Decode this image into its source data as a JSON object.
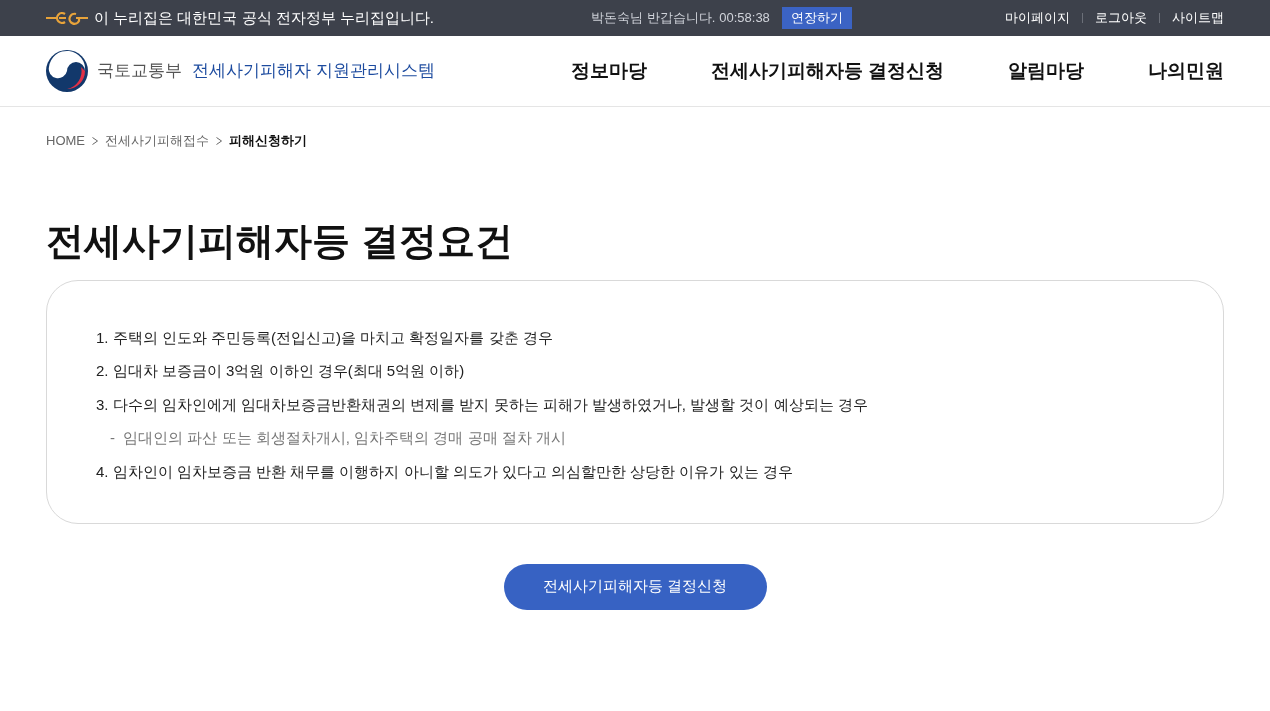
{
  "top_bar": {
    "notice": "이 누리집은 대한민국 공식 전자정부 누리집입니다.",
    "greeting": "박돈숙님 반갑습니다.",
    "timer": "00:58:38",
    "extend_button": "연장하기",
    "links": [
      "마이페이지",
      "로그아웃",
      "사이트맵"
    ]
  },
  "header": {
    "ministry": "국토교통부",
    "system_name": "전세사기피해자 지원관리시스템",
    "nav": [
      "정보마당",
      "전세사기피해자등 결정신청",
      "알림마당",
      "나의민원"
    ]
  },
  "breadcrumb": [
    {
      "label": "HOME",
      "current": false
    },
    {
      "label": "전세사기피해접수",
      "current": false
    },
    {
      "label": "피해신청하기",
      "current": true
    }
  ],
  "page_title": "전세사기피해자등 결정요건",
  "requirements": [
    {
      "kind": "item",
      "text": "1. 주택의 인도와 주민등록(전입신고)을 마치고 확정일자를 갖춘 경우"
    },
    {
      "kind": "item",
      "text": "2. 임대차 보증금이 3억원 이하인 경우(최대 5억원 이하)"
    },
    {
      "kind": "item",
      "text": "3. 다수의 임차인에게 임대차보증금반환채권의 변제를 받지 못하는 피해가 발생하였거나, 발생할 것이 예상되는 경우"
    },
    {
      "kind": "note",
      "text": "-  임대인의 파산 또는 회생절차개시, 임차주택의 경매 공매 절차 개시"
    },
    {
      "kind": "item",
      "text": "4. 임차인이 임차보증금 반환 채무를 이행하지 아니할 의도가 있다고 의심할만한 상당한 이유가 있는 경우"
    }
  ],
  "apply_button": "전세사기피해자등 결정신청"
}
